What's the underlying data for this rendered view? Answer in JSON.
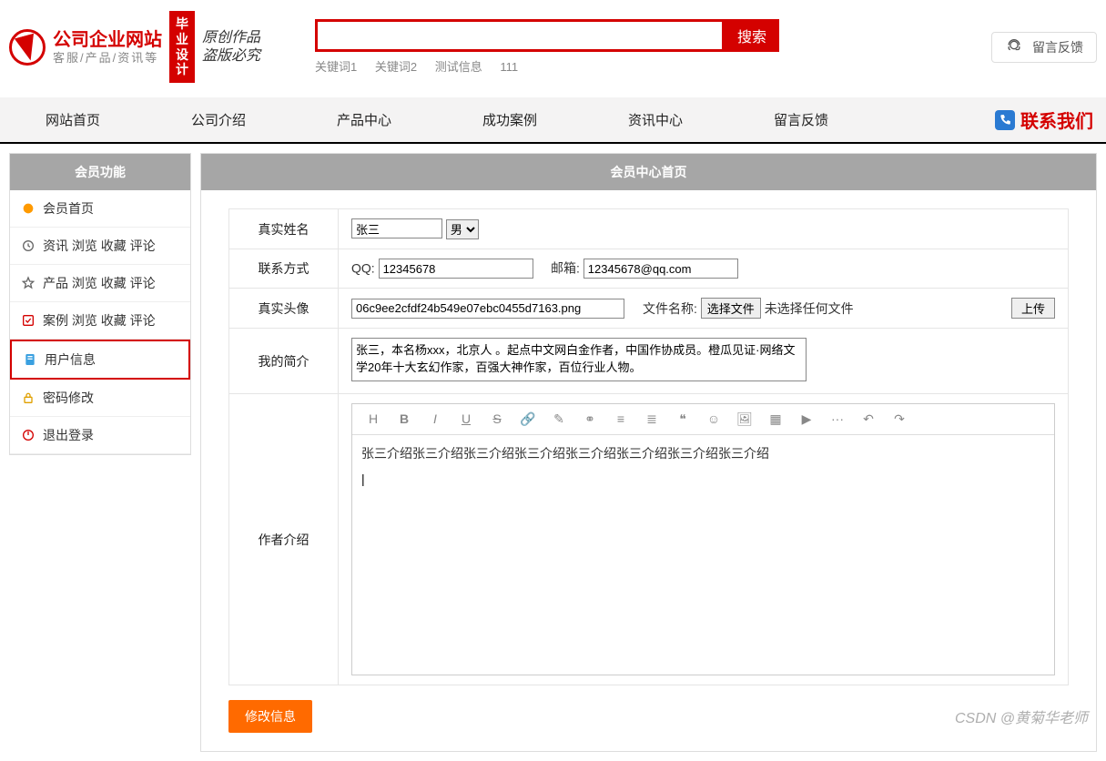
{
  "header": {
    "site_title": "公司企业网站",
    "site_sub": "客服/产品/资讯等",
    "badge": "毕业设计",
    "slogan1": "原创作品",
    "slogan2": "盗版必究",
    "search_btn": "搜索",
    "keywords": [
      "关键词1",
      "关键词2",
      "测试信息",
      "111"
    ],
    "feedback": "留言反馈"
  },
  "nav": {
    "items": [
      "网站首页",
      "公司介绍",
      "产品中心",
      "成功案例",
      "资讯中心",
      "留言反馈"
    ],
    "contact": "联系我们"
  },
  "sidebar": {
    "title": "会员功能",
    "items": [
      {
        "label": "会员首页",
        "icon": "home"
      },
      {
        "label": "资讯 浏览 收藏 评论",
        "icon": "clock"
      },
      {
        "label": "产品 浏览 收藏 评论",
        "icon": "star"
      },
      {
        "label": "案例 浏览 收藏 评论",
        "icon": "check"
      },
      {
        "label": "用户信息",
        "icon": "user",
        "active": true
      },
      {
        "label": "密码修改",
        "icon": "lock"
      },
      {
        "label": "退出登录",
        "icon": "power"
      }
    ]
  },
  "content": {
    "title": "会员中心首页",
    "labels": {
      "real_name": "真实姓名",
      "contact": "联系方式",
      "avatar": "真实头像",
      "bio": "我的简介",
      "author": "作者介绍"
    },
    "form": {
      "name": "张三",
      "gender": "男",
      "qq_label": "QQ:",
      "qq": "12345678",
      "email_label": "邮箱:",
      "email": "12345678@qq.com",
      "avatar_file": "06c9ee2cfdf24b549e07ebc0455d7163.png",
      "file_label": "文件名称:",
      "choose_file": "选择文件",
      "no_file": "未选择任何文件",
      "upload": "上传",
      "bio_text": "张三，本名杨xxx，北京人 。起点中文网白金作者，中国作协成员。橙瓜见证·网络文学20年十大玄幻作家，百强大神作家，百位行业人物。",
      "editor_text": "张三介绍张三介绍张三介绍张三介绍张三介绍张三介绍张三介绍张三介绍"
    },
    "submit": "修改信息"
  },
  "editor_tools": [
    "H",
    "B",
    "I",
    "U",
    "S",
    "🔗",
    "✎",
    "⚭",
    "≡",
    "≣",
    "❝",
    "☺",
    "🖼",
    "▦",
    "▶",
    "···",
    "↶",
    "↷"
  ],
  "watermark": "CSDN @黄菊华老师"
}
